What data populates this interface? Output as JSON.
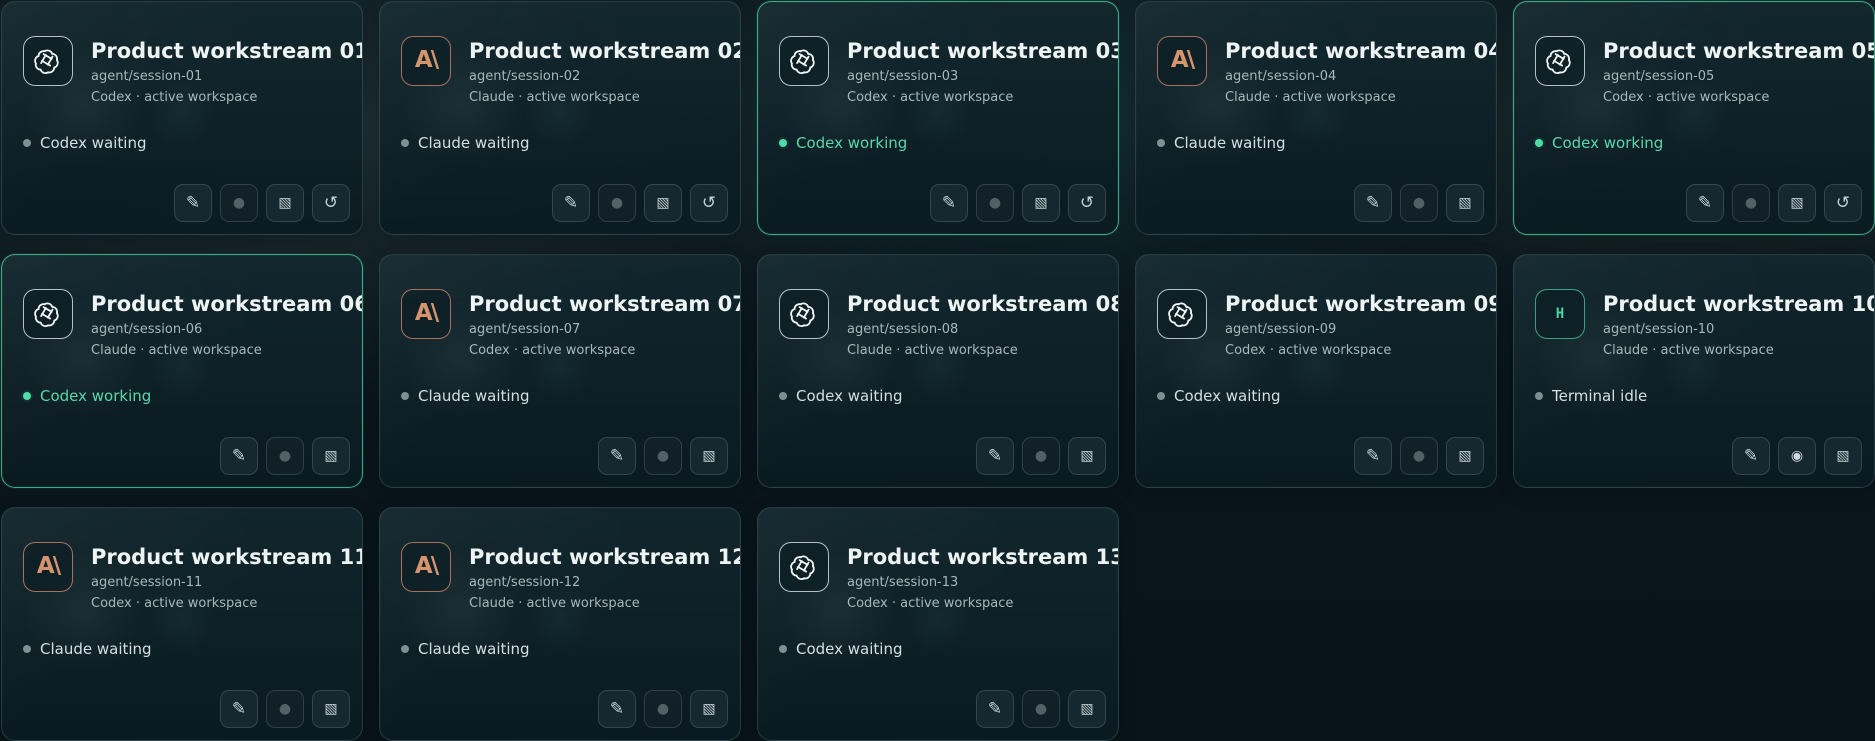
{
  "cards": [
    {
      "title": "Product workstream 01",
      "path": "agent/session-01",
      "meta": "Codex · active workspace",
      "status": "Codex waiting",
      "status_state": "idle",
      "agent_icon": "openai-icon",
      "active": false,
      "actions": [
        "edit-icon",
        "record-icon-faded",
        "hatch-icon",
        "refresh-icon"
      ]
    },
    {
      "title": "Product workstream 02",
      "path": "agent/session-02",
      "meta": "Claude · active workspace",
      "status": "Claude waiting",
      "status_state": "idle",
      "agent_icon": "claude-icon",
      "active": false,
      "actions": [
        "edit-icon",
        "record-icon-faded",
        "hatch-icon",
        "refresh-icon"
      ]
    },
    {
      "title": "Product workstream 03",
      "path": "agent/session-03",
      "meta": "Codex · active workspace",
      "status": "Codex working",
      "status_state": "live",
      "agent_icon": "openai-icon",
      "active": true,
      "actions": [
        "edit-icon",
        "record-icon-faded",
        "hatch-icon",
        "refresh-icon"
      ]
    },
    {
      "title": "Product workstream 04",
      "path": "agent/session-04",
      "meta": "Claude · active workspace",
      "status": "Claude waiting",
      "status_state": "idle",
      "agent_icon": "claude-icon",
      "active": false,
      "actions": [
        "edit-icon",
        "record-icon-faded",
        "hatch-icon"
      ]
    },
    {
      "title": "Product workstream 05",
      "path": "agent/session-05",
      "meta": "Codex · active workspace",
      "status": "Codex working",
      "status_state": "live",
      "agent_icon": "openai-icon",
      "active": true,
      "actions": [
        "edit-icon",
        "record-icon-faded",
        "hatch-icon",
        "refresh-icon"
      ]
    },
    {
      "title": "Product workstream 06",
      "path": "agent/session-06",
      "meta": "Claude · active workspace",
      "status": "Codex working",
      "status_state": "live",
      "agent_icon": "openai-icon",
      "active": true,
      "actions": [
        "edit-icon",
        "record-icon-faded",
        "hatch-icon"
      ]
    },
    {
      "title": "Product workstream 07",
      "path": "agent/session-07",
      "meta": "Codex · active workspace",
      "status": "Claude waiting",
      "status_state": "idle",
      "agent_icon": "claude-icon",
      "active": false,
      "actions": [
        "edit-icon",
        "record-icon-faded",
        "hatch-icon"
      ]
    },
    {
      "title": "Product workstream 08",
      "path": "agent/session-08",
      "meta": "Claude · active workspace",
      "status": "Codex waiting",
      "status_state": "idle",
      "agent_icon": "openai-icon",
      "active": false,
      "actions": [
        "edit-icon",
        "record-icon-faded",
        "hatch-icon"
      ]
    },
    {
      "title": "Product workstream 09",
      "path": "agent/session-09",
      "meta": "Codex · active workspace",
      "status": "Codex waiting",
      "status_state": "idle",
      "agent_icon": "openai-icon",
      "active": false,
      "actions": [
        "edit-icon",
        "record-icon-faded",
        "hatch-icon"
      ]
    },
    {
      "title": "Product workstream 10",
      "path": "agent/session-10",
      "meta": "Claude · active workspace",
      "status": "Terminal idle",
      "status_state": "idle",
      "agent_icon": "terminal-icon",
      "agent_icon_text": "H",
      "active": false,
      "actions": [
        "edit-icon",
        "record-icon-bright",
        "hatch-icon"
      ]
    },
    {
      "title": "Product workstream 11",
      "path": "agent/session-11",
      "meta": "Codex · active workspace",
      "status": "Claude waiting",
      "status_state": "idle",
      "agent_icon": "claude-icon",
      "active": false,
      "actions": [
        "edit-icon",
        "record-icon-faded",
        "hatch-icon"
      ]
    },
    {
      "title": "Product workstream 12",
      "path": "agent/session-12",
      "meta": "Claude · active workspace",
      "status": "Claude waiting",
      "status_state": "idle",
      "agent_icon": "claude-icon",
      "active": false,
      "actions": [
        "edit-icon",
        "record-icon-faded",
        "hatch-icon"
      ]
    },
    {
      "title": "Product workstream 13",
      "path": "agent/session-13",
      "meta": "Codex · active workspace",
      "status": "Codex waiting",
      "status_state": "idle",
      "agent_icon": "openai-icon",
      "active": false,
      "actions": [
        "edit-icon",
        "record-icon-faded",
        "hatch-icon"
      ]
    }
  ],
  "theme": {
    "background": "#081419",
    "card": "#10242b",
    "accent": "#4fdca6",
    "text": "#eef4f4",
    "muted": "#a8b7b9",
    "claude": "#d6946e"
  }
}
